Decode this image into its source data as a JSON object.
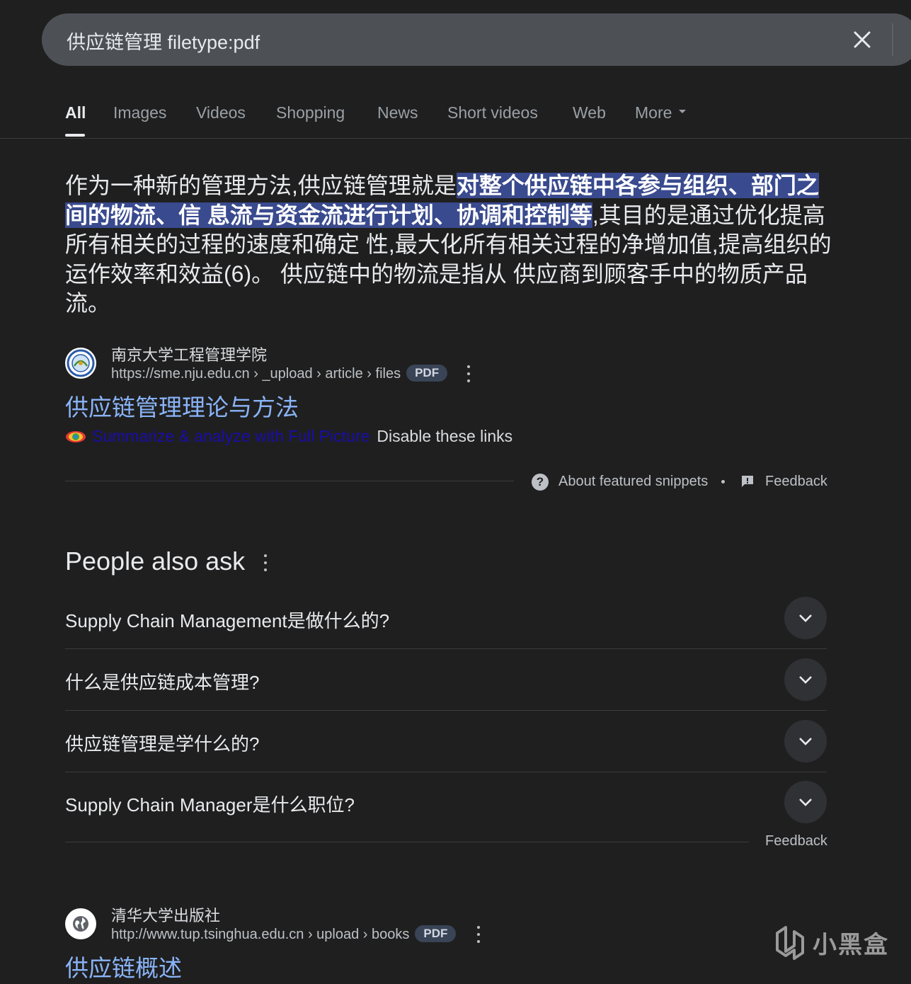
{
  "search": {
    "query": "供应链管理 filetype:pdf"
  },
  "tabs": [
    {
      "label": "All"
    },
    {
      "label": "Images"
    },
    {
      "label": "Videos"
    },
    {
      "label": "Shopping"
    },
    {
      "label": "News"
    },
    {
      "label": "Short videos"
    },
    {
      "label": "Web"
    },
    {
      "label": "More"
    }
  ],
  "snippet": {
    "before": "作为一种新的管理方法,供应链管理就是",
    "highlight": "对整个供应链中各参与组织、部门之间的物流、信 息流与资金流进行计划、协调和控制等",
    "after": ",其目的是通过优化提高所有相关的过程的速度和确定 性,最大化所有相关过程的净增加值,提高组织的运作效率和效益(6)。 供应链中的物流是指从 供应商到顾客手中的物质产品流。"
  },
  "result1": {
    "site_name": "南京大学工程管理学院",
    "url": "https://sme.nju.edu.cn › _upload › article › files",
    "badge": "PDF",
    "title": "供应链管理理论与方法"
  },
  "extension": {
    "summarize_link": "Summarize & analyze with Full Picture",
    "disable_link": "Disable these links"
  },
  "snippet_footer": {
    "about": "About featured snippets",
    "feedback": "Feedback"
  },
  "paa": {
    "title": "People also ask",
    "questions": [
      "Supply Chain Management是做什么的?",
      "什么是供应链成本管理?",
      "供应链管理是学什么的?",
      "Supply Chain Manager是什么职位?"
    ],
    "feedback": "Feedback"
  },
  "result2": {
    "site_name": "清华大学出版社",
    "url": "http://www.tup.tsinghua.edu.cn › upload › books",
    "badge": "PDF",
    "title": "供应链概述"
  },
  "watermark": {
    "text": "小黑盒"
  },
  "colors": {
    "background": "#1f1f1f",
    "link": "#8ab4f8",
    "highlight": "#394a8e",
    "search_bar": "#4d5156"
  }
}
